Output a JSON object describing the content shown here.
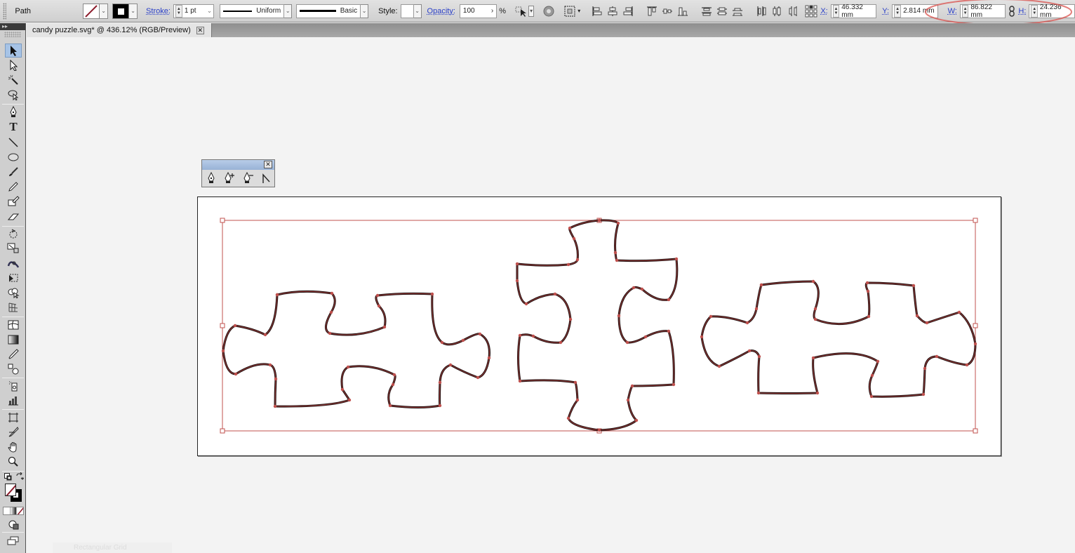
{
  "control_bar": {
    "selection_type": "Path",
    "stroke_label": "Stroke:",
    "stroke_weight": "1 pt",
    "variable_width_profile": "Uniform",
    "brush_definition": "Basic",
    "style_label": "Style:",
    "opacity_label": "Opacity:",
    "opacity_value": "100",
    "opacity_unit": "%",
    "x_label": "X:",
    "x_value": "46.332 mm",
    "y_label": "Y:",
    "y_value": "2.814 mm",
    "w_label": "W:",
    "w_value": "86.822 mm",
    "h_label": "H:",
    "h_value": "24.236 mm",
    "annotation_color": "#d9534f"
  },
  "document_tab": {
    "title": "candy puzzle.svg* @ 436.12% (RGB/Preview)",
    "close_symbol": "✕"
  },
  "toolbox": {
    "collapse_symbol": "▸▸",
    "tools": [
      {
        "name": "selection-tool",
        "active": true
      },
      {
        "name": "direct-selection-tool"
      },
      {
        "name": "magic-wand-tool"
      },
      {
        "name": "lasso-tool"
      },
      {
        "name": "pen-tool"
      },
      {
        "name": "type-tool",
        "glyph": "T"
      },
      {
        "name": "line-segment-tool"
      },
      {
        "name": "ellipse-tool"
      },
      {
        "name": "paintbrush-tool"
      },
      {
        "name": "pencil-tool"
      },
      {
        "name": "blob-brush-tool"
      },
      {
        "name": "eraser-tool"
      },
      {
        "name": "rotate-tool"
      },
      {
        "name": "scale-tool"
      },
      {
        "name": "warp-tool"
      },
      {
        "name": "free-transform-tool"
      },
      {
        "name": "shape-builder-tool"
      },
      {
        "name": "perspective-grid-tool"
      },
      {
        "name": "mesh-tool"
      },
      {
        "name": "gradient-tool"
      },
      {
        "name": "eyedropper-tool"
      },
      {
        "name": "blend-tool"
      },
      {
        "name": "symbol-sprayer-tool"
      },
      {
        "name": "column-graph-tool"
      },
      {
        "name": "artboard-tool"
      },
      {
        "name": "slice-tool"
      },
      {
        "name": "hand-tool"
      },
      {
        "name": "zoom-tool"
      }
    ]
  },
  "pen_panel": {
    "close_symbol": "✕",
    "tools": [
      "pen-tool",
      "add-anchor-point-tool",
      "delete-anchor-point-tool",
      "convert-anchor-point-tool"
    ]
  },
  "canvas": {
    "selection_color": "#c0504d",
    "stroke_color": "#1a0a0a",
    "pieces": [
      "left-puzzle-piece",
      "center-puzzle-piece",
      "right-puzzle-piece"
    ]
  },
  "ghost_panel": {
    "label": "Rectangular Grid"
  }
}
